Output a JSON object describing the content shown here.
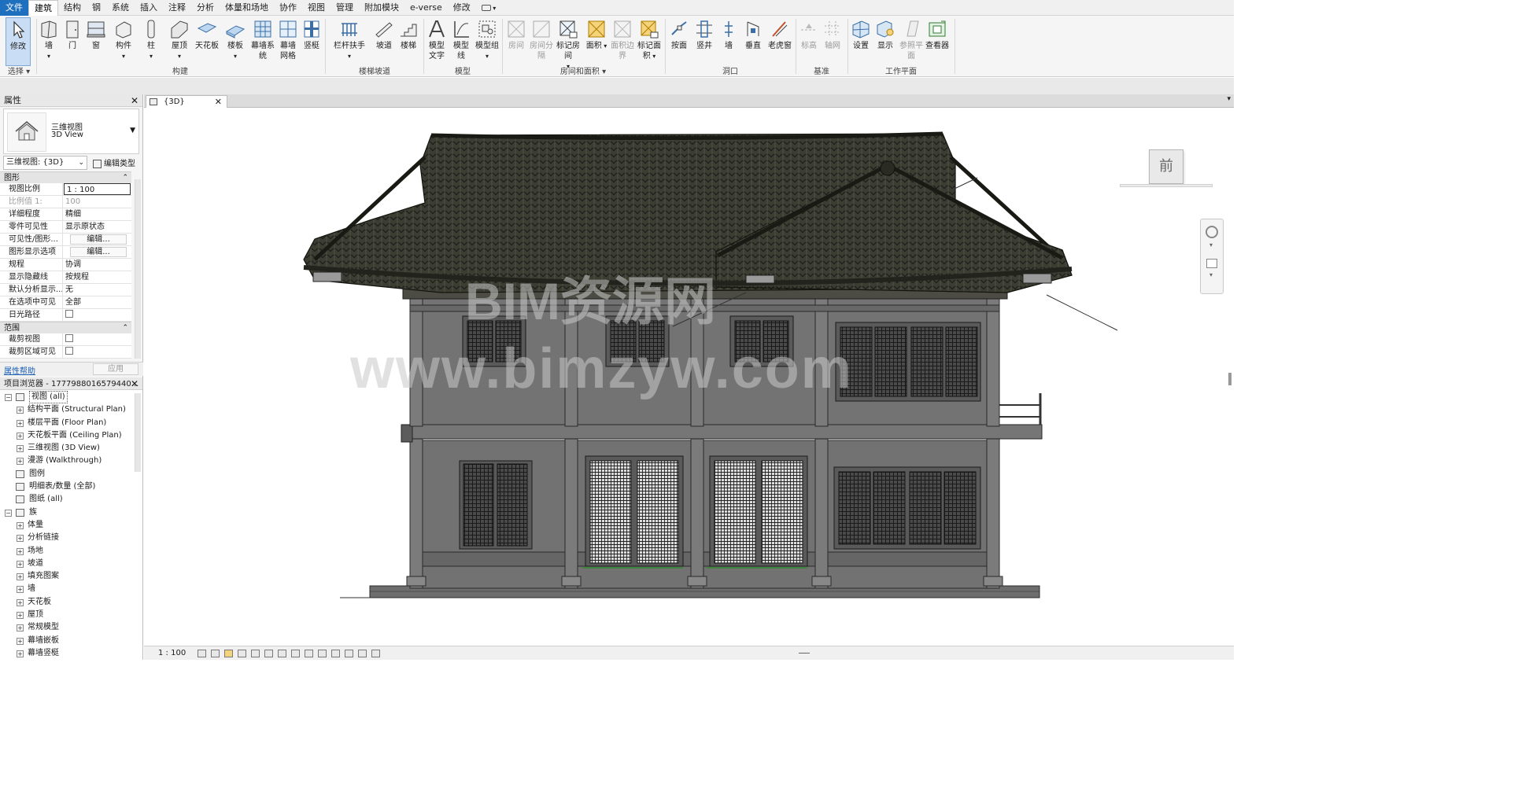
{
  "ribbon": {
    "tabs": [
      "文件",
      "建筑",
      "结构",
      "钢",
      "系统",
      "插入",
      "注释",
      "分析",
      "体量和场地",
      "协作",
      "视图",
      "管理",
      "附加模块",
      "e-verse",
      "修改"
    ],
    "active_tab": "建筑",
    "buttons": {
      "modify": "修改",
      "wall": "墙",
      "door": "门",
      "window": "窗",
      "component": "构件",
      "column": "柱",
      "roof": "屋顶",
      "ceiling": "天花板",
      "floor": "楼板",
      "curtain_system": "幕墙系统",
      "curtain_grid": "幕墙网格",
      "mullion": "竖梃",
      "railing": "栏杆扶手",
      "ramp": "坡道",
      "stair": "楼梯",
      "model_text": "模型文字",
      "model_line": "模型线",
      "model_group": "模型组",
      "room": "房间",
      "room_separator": "房间分隔",
      "tag_room": "标记房间",
      "area": "面积",
      "area_boundary": "面积边界",
      "tag_area": "标记面积",
      "by_face": "按面",
      "shaft": "竖井",
      "opening_wall": "墙",
      "vertical": "垂直",
      "dormer": "老虎窗",
      "level": "标高",
      "grid": "轴网",
      "set": "设置",
      "show": "显示",
      "ref_plane": "参照平面",
      "viewer": "查看器"
    },
    "groups": {
      "select": "选择",
      "build": "构建",
      "circulation": "楼梯坡道",
      "model": "模型",
      "room_area": "房间和面积",
      "opening": "洞口",
      "datum": "基准",
      "work_plane": "工作平面"
    }
  },
  "properties": {
    "title": "属性",
    "type_name_cn": "三维视图",
    "type_name_en": "3D View",
    "selector": "三维视图: {3D}",
    "edit_type": "编辑类型",
    "sections": {
      "graphics": "图形",
      "extents": "范围"
    },
    "rows": [
      {
        "k": "视图比例",
        "v": "1 : 100"
      },
      {
        "k": "比例值 1:",
        "v": "100"
      },
      {
        "k": "详细程度",
        "v": "精细"
      },
      {
        "k": "零件可见性",
        "v": "显示原状态"
      },
      {
        "k": "可见性/图形...",
        "v": "编辑..."
      },
      {
        "k": "图形显示选项",
        "v": "编辑..."
      },
      {
        "k": "规程",
        "v": "协调"
      },
      {
        "k": "显示隐藏线",
        "v": "按规程"
      },
      {
        "k": "默认分析显示...",
        "v": "无"
      },
      {
        "k": "在选项中可见",
        "v": "全部"
      },
      {
        "k": "日光路径",
        "v": ""
      }
    ],
    "extent_rows": [
      {
        "k": "裁剪视图",
        "v": ""
      },
      {
        "k": "裁剪区域可见",
        "v": ""
      }
    ],
    "help": "属性帮助",
    "apply": "应用"
  },
  "browser": {
    "title": "项目浏览器 - 1777988016579440...",
    "items": [
      {
        "label": "视图 (all)",
        "level": 0,
        "pm": "−"
      },
      {
        "label": "结构平面 (Structural Plan)",
        "level": 1,
        "pm": "+"
      },
      {
        "label": "楼层平面 (Floor Plan)",
        "level": 1,
        "pm": "+"
      },
      {
        "label": "天花板平面 (Ceiling Plan)",
        "level": 1,
        "pm": "+"
      },
      {
        "label": "三维视图 (3D View)",
        "level": 1,
        "pm": "+"
      },
      {
        "label": "漫游 (Walkthrough)",
        "level": 1,
        "pm": "+"
      },
      {
        "label": "图例",
        "level": 0,
        "pm": ""
      },
      {
        "label": "明细表/数量 (全部)",
        "level": 0,
        "pm": ""
      },
      {
        "label": "图纸 (all)",
        "level": 0,
        "pm": ""
      },
      {
        "label": "族",
        "level": 0,
        "pm": "−"
      },
      {
        "label": "体量",
        "level": 1,
        "pm": "+"
      },
      {
        "label": "分析链接",
        "level": 1,
        "pm": "+"
      },
      {
        "label": "场地",
        "level": 1,
        "pm": "+"
      },
      {
        "label": "坡道",
        "level": 1,
        "pm": "+"
      },
      {
        "label": "填充图案",
        "level": 1,
        "pm": "+"
      },
      {
        "label": "墙",
        "level": 1,
        "pm": "+"
      },
      {
        "label": "天花板",
        "level": 1,
        "pm": "+"
      },
      {
        "label": "屋顶",
        "level": 1,
        "pm": "+"
      },
      {
        "label": "常规模型",
        "level": 1,
        "pm": "+"
      },
      {
        "label": "幕墙嵌板",
        "level": 1,
        "pm": "+"
      },
      {
        "label": "幕墙竖梃",
        "level": 1,
        "pm": "+"
      }
    ]
  },
  "view": {
    "tab_label": "{3D}",
    "viewcube_face": "前",
    "watermark_1": "BIM资源网",
    "watermark_2": "www.bimzyw.com"
  },
  "status": {
    "scale": "1 : 100"
  },
  "colors": {
    "accent": "#1f6fbf",
    "roof": "#3c3d33",
    "wall": "#6f6f6f"
  }
}
